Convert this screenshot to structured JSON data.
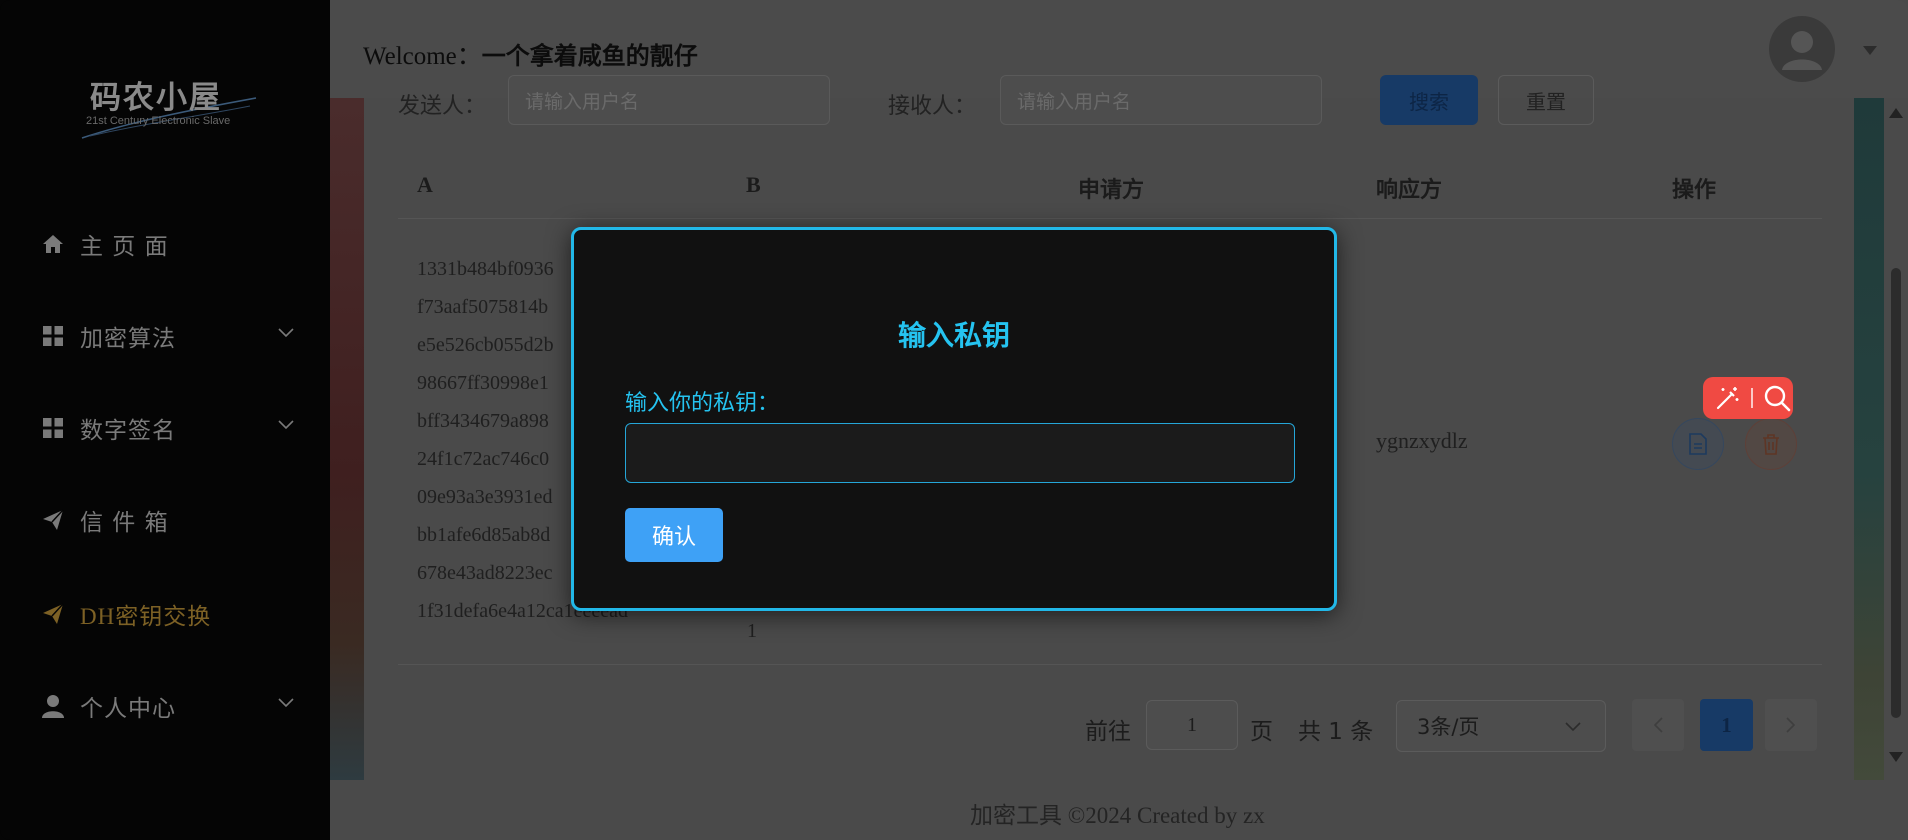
{
  "header": {
    "welcome_prefix": "Welcome：",
    "username": "一个拿着咸鱼的靓仔"
  },
  "sidebar": {
    "logo_main": "码农小屋",
    "logo_sub": "21st Century Electronic Slave",
    "items": [
      {
        "label": "主 页 面",
        "icon": "home-icon",
        "has_submenu": false
      },
      {
        "label": "加密算法",
        "icon": "grid-icon",
        "has_submenu": true
      },
      {
        "label": "数字签名",
        "icon": "grid-icon",
        "has_submenu": true
      },
      {
        "label": "信 件 箱",
        "icon": "send-icon",
        "has_submenu": false
      },
      {
        "label": "DH密钥交换",
        "icon": "send-icon",
        "has_submenu": false,
        "active": true
      },
      {
        "label": "个人中心",
        "icon": "user-icon",
        "has_submenu": true
      }
    ]
  },
  "search": {
    "sender_label": "发送人：",
    "sender_placeholder": "请输入用户名",
    "receiver_label": "接收人：",
    "receiver_placeholder": "请输入用户名",
    "search_label": "搜索",
    "reset_label": "重置"
  },
  "table": {
    "columns": [
      "A",
      "B",
      "申请方",
      "响应方",
      "操作"
    ],
    "rows": [
      {
        "a_lines": [
          "1331b484bf0936",
          "f73aaf5075814b",
          "e5e526cb055d2b",
          "98667ff30998e1",
          "bff3434679a898",
          "24f1c72ac746c0",
          "09e93a3e3931ed",
          "bb1afe6d85ab8d",
          "678e43ad8223ec",
          "1f31defa6e4a12ca1eeeead"
        ],
        "b": "1",
        "responder": "ygnzxydlz"
      }
    ]
  },
  "pagination": {
    "goto_label": "前往",
    "goto_value": "1",
    "page_unit": "页",
    "total_label": "共 1 条",
    "page_size": "3条/页",
    "current_page": "1"
  },
  "footer": {
    "text": "加密工具 ©2024 Created by zx"
  },
  "modal": {
    "title": "输入私钥",
    "field_label": "输入你的私钥：",
    "field_value": "",
    "confirm_label": "确认"
  },
  "colors": {
    "accent": "#25c3f0",
    "primary_button": "#3ea1f6",
    "active_menu": "#7d6125",
    "widget": "#f04a43"
  }
}
